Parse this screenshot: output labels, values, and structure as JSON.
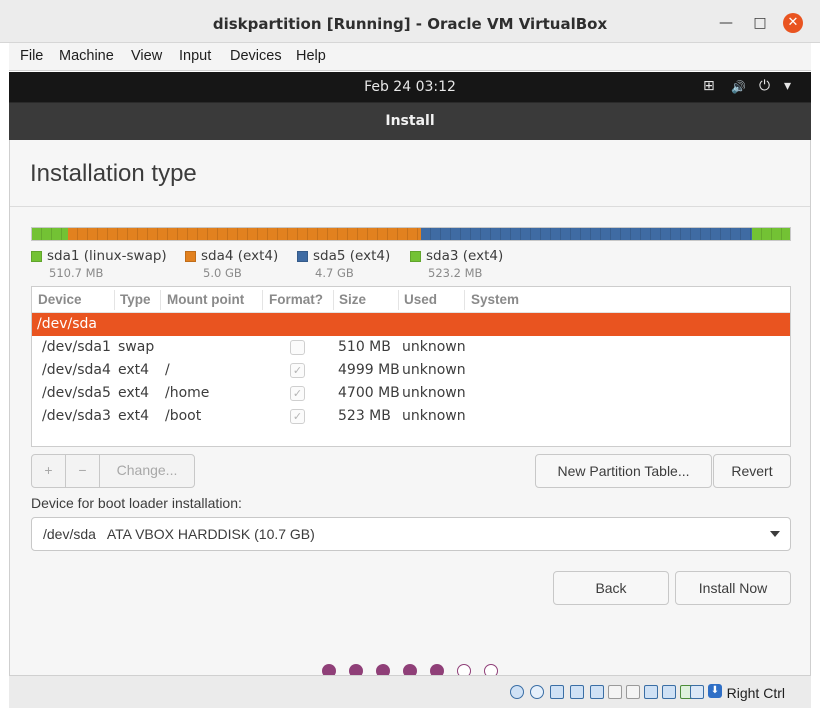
{
  "window": {
    "title": "diskpartition [Running] - Oracle VM VirtualBox",
    "minimize_glyph": "—",
    "maximize_glyph": "□",
    "close_glyph": "✕"
  },
  "menubar": {
    "items": [
      "File",
      "Machine",
      "View",
      "Input",
      "Devices",
      "Help"
    ]
  },
  "guest_topbar": {
    "clock": "Feb 24  03:12",
    "network_icon": "⊞",
    "volume_icon": "🔊",
    "power_icon": "⏻",
    "menu_arrow": "▾"
  },
  "installer": {
    "header_title": "Install",
    "page_title": "Installation type"
  },
  "partition_bar": {
    "segments": [
      {
        "name": "sda1",
        "color": "#73c234",
        "fraction": 0.048
      },
      {
        "name": "sda4",
        "color": "#e2811f",
        "fraction": 0.465
      },
      {
        "name": "sda5",
        "color": "#3f6ba3",
        "fraction": 0.437
      },
      {
        "name": "sda3",
        "color": "#73c234",
        "fraction": 0.05
      }
    ]
  },
  "legend": [
    {
      "label": "sda1 (linux-swap)",
      "size": "510.7 MB",
      "color": "#73c234"
    },
    {
      "label": "sda4 (ext4)",
      "size": "5.0 GB",
      "color": "#e2811f"
    },
    {
      "label": "sda5 (ext4)",
      "size": "4.7 GB",
      "color": "#3f6ba3"
    },
    {
      "label": "sda3 (ext4)",
      "size": "523.2 MB",
      "color": "#73c234"
    }
  ],
  "table": {
    "headers": [
      "Device",
      "Type",
      "Mount point",
      "Format?",
      "Size",
      "Used",
      "System"
    ],
    "selected_row": "/dev/sda",
    "rows": [
      {
        "device": "/dev/sda1",
        "type": "swap",
        "mount": "",
        "format": false,
        "size": "510 MB",
        "used": "unknown"
      },
      {
        "device": "/dev/sda4",
        "type": "ext4",
        "mount": "/",
        "format": true,
        "size": "4999 MB",
        "used": "unknown"
      },
      {
        "device": "/dev/sda5",
        "type": "ext4",
        "mount": "/home",
        "format": true,
        "size": "4700 MB",
        "used": "unknown"
      },
      {
        "device": "/dev/sda3",
        "type": "ext4",
        "mount": "/boot",
        "format": true,
        "size": "523 MB",
        "used": "unknown"
      }
    ],
    "check_glyph": "✓"
  },
  "actions": {
    "add_label": "+",
    "remove_label": "−",
    "change_label": "Change...",
    "new_table_label": "New Partition Table...",
    "revert_label": "Revert"
  },
  "boot_loader": {
    "label": "Device for boot loader installation:",
    "value": "/dev/sda   ATA VBOX HARDDISK (10.7 GB)"
  },
  "nav": {
    "back_label": "Back",
    "install_label": "Install Now"
  },
  "progress": {
    "total_steps": 7,
    "completed_steps": 5
  },
  "statusbar": {
    "host_key": "Right Ctrl"
  }
}
